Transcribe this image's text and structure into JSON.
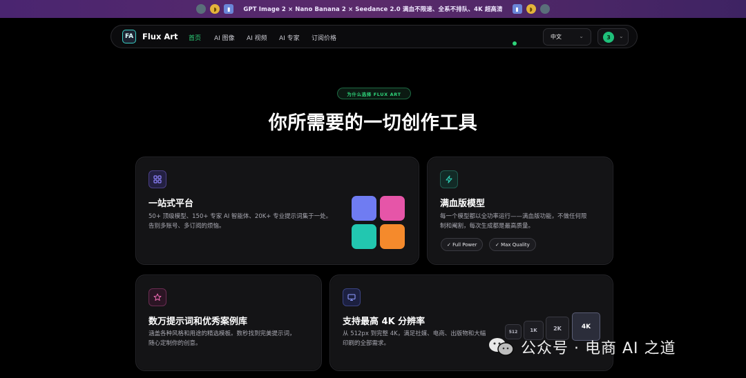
{
  "banner": {
    "text": "GPT Image 2 × Nano Banana 2 × Seedance 2.0 满血不限速、全系不排队、4K 超高清"
  },
  "nav": {
    "brand": "Flux Art",
    "logo_mark": "FA",
    "links": [
      "首页",
      "AI 图像",
      "AI 视频",
      "AI 专家",
      "订阅价格"
    ],
    "active_index": 0,
    "language": "中文",
    "credits": "3"
  },
  "hero": {
    "eyebrow": "为什么选择 FLUX ART",
    "headline": "你所需要的一切创作工具"
  },
  "cards": {
    "platform": {
      "title": "一站式平台",
      "desc_line1": "50+ 顶级模型、150+ 专家 AI 智能体、20K+ 专业提示词集于一处。",
      "desc_line2": "告别多账号、多订阅的烦恼。",
      "tile_colors": [
        "#6f7cf2",
        "#e655a8",
        "#22c7b0",
        "#f58a2c"
      ]
    },
    "full_power": {
      "title": "满血版模型",
      "desc_line1": "每一个模型都以全功率运行——满血版功能，不做任何限",
      "desc_line2": "制和阉割，每次生成都是最高质量。",
      "pills": [
        "✓ Full Power",
        "✓ Max Quality"
      ]
    },
    "prompts": {
      "title": "数万提示词和优秀案例库",
      "desc_line1": "涵盖各种风格和用途的精选模板。数秒找到完美提示词，",
      "desc_line2": "随心定制你的创意。"
    },
    "resolution": {
      "title": "支持最高 4K 分辨率",
      "desc_line1": "从 512px 到完整 4K，满足社媒、电商、出版物和大幅",
      "desc_line2": "印刷的全部需求。",
      "sizes": [
        "512",
        "1K",
        "2K",
        "4K"
      ]
    }
  },
  "watermark": {
    "text": "公众号 · 电商 AI 之道"
  },
  "colors": {
    "accent_green": "#2ed47a",
    "card_bg": "#141416",
    "banner_purple": "#4a2570"
  }
}
